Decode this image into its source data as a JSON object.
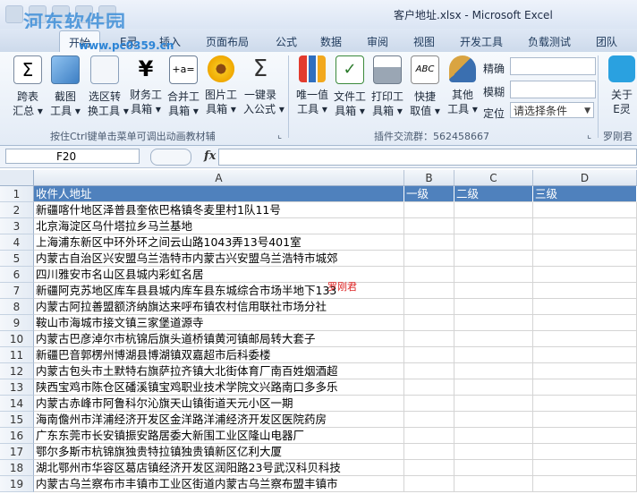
{
  "window": {
    "title": "客户地址.xlsx - Microsoft Excel"
  },
  "watermark": {
    "name": "河东软件园",
    "url": "www.pc0359.cn"
  },
  "tabs": [
    {
      "label": "开始",
      "active": true
    },
    {
      "label": "E灵"
    },
    {
      "label": "插入"
    },
    {
      "label": "页面布局"
    },
    {
      "label": "公式"
    },
    {
      "label": "数据"
    },
    {
      "label": "审阅"
    },
    {
      "label": "视图"
    },
    {
      "label": "开发工具"
    },
    {
      "label": "负载测试"
    },
    {
      "label": "团队"
    }
  ],
  "ribbon": {
    "buttons": [
      {
        "line1": "跨表",
        "line2": "汇总 ▾",
        "icon": "sigma-table-icon"
      },
      {
        "line1": "截图",
        "line2": "工具 ▾",
        "icon": "screenshot-icon"
      },
      {
        "line1": "选区转",
        "line2": "换工具 ▾",
        "icon": "convert-icon"
      },
      {
        "line1": "财务工",
        "line2": "具箱 ▾",
        "icon": "yen-icon"
      },
      {
        "line1": "合并工",
        "line2": "具箱 ▾",
        "icon": "merge-icon"
      },
      {
        "line1": "图片工",
        "line2": "具箱 ▾",
        "icon": "flower-icon"
      },
      {
        "line1": "一键录",
        "line2": "入公式 ▾",
        "icon": "sigma-icon"
      },
      {
        "line1": "唯一值",
        "line2": "工具 ▾",
        "icon": "bar-chart-icon"
      },
      {
        "line1": "文件工",
        "line2": "具箱 ▾",
        "icon": "excel-file-icon"
      },
      {
        "line1": "打印工",
        "line2": "具箱 ▾",
        "icon": "printer-icon"
      },
      {
        "line1": "快捷",
        "line2": "取值 ▾",
        "icon": "abc-icon"
      },
      {
        "line1": "其他",
        "line2": "工具 ▾",
        "icon": "brush-icon"
      },
      {
        "line1": "关于",
        "line2": "E灵",
        "icon": "bird-icon"
      }
    ],
    "side_labels": {
      "precise": "精确",
      "fuzzy": "模糊",
      "locate": "定位"
    },
    "condition_placeholder": "请选择条件",
    "group1_label": "按住Ctrl键单击菜单可调出动画教材辅",
    "group2_label": "插件交流群：562458667",
    "group3_label": "罗刚君"
  },
  "formula_bar": {
    "name_box": "F20",
    "fx": "fx",
    "formula": ""
  },
  "columns": [
    "A",
    "B",
    "C",
    "D"
  ],
  "sheet": {
    "header": {
      "a": "收件人地址",
      "b": "一级",
      "c": "二级",
      "d": "三级"
    },
    "rows": [
      {
        "n": "2",
        "a": "新疆喀什地区泽普县奎依巴格镇冬麦里村1队11号"
      },
      {
        "n": "3",
        "a": "北京海淀区乌什塔拉乡马兰基地"
      },
      {
        "n": "4",
        "a": "上海浦东新区中环外环之间云山路1043弄13号401室"
      },
      {
        "n": "5",
        "a": "内蒙古自治区兴安盟乌兰浩特市内蒙古兴安盟乌兰浩特市城郊"
      },
      {
        "n": "6",
        "a": "四川雅安市名山区县城内彩虹名居"
      },
      {
        "n": "7",
        "a": "新疆阿克苏地区库车县县城内库车县东城综合市场半地下133"
      },
      {
        "n": "8",
        "a": "内蒙古阿拉善盟额济纳旗达来呼布镇农村信用联社市场分社"
      },
      {
        "n": "9",
        "a": "鞍山市海城市接文镇三家堡道源寺"
      },
      {
        "n": "10",
        "a": "内蒙古巴彦淖尔市杭锦后旗头道桥镇黄河镇邮局转大套子"
      },
      {
        "n": "11",
        "a": "新疆巴音郭楞州博湖县博湖镇双嘉超市后科委楼"
      },
      {
        "n": "12",
        "a": "内蒙古包头市土默特右旗萨拉齐镇大北街体育厂南百姓烟酒超"
      },
      {
        "n": "13",
        "a": "陕西宝鸡市陈仓区磻溪镇宝鸡职业技术学院文兴路南口多多乐"
      },
      {
        "n": "14",
        "a": "内蒙古赤峰市阿鲁科尔沁旗天山镇街道天元小区一期"
      },
      {
        "n": "15",
        "a": "海南儋州市洋浦经济开发区金洋路洋浦经济开发区医院药房"
      },
      {
        "n": "16",
        "a": "广东东莞市长安镇振安路居委大新围工业区隆山电器厂"
      },
      {
        "n": "17",
        "a": "鄂尔多斯市杭锦旗独贵特拉镇独贵镇新区亿利大厦"
      },
      {
        "n": "18",
        "a": "湖北鄂州市华容区葛店镇经济开发区润阳路23号武汉科贝科技"
      },
      {
        "n": "19",
        "a": "内蒙古乌兰察布市丰镇市工业区街道内蒙古乌兰察布盟丰镇市"
      }
    ]
  },
  "overlay_note": "罗刚君",
  "colors": {
    "header_fill": "#4f81bd",
    "accent": "#2b579a"
  }
}
